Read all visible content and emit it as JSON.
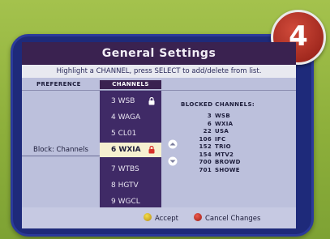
{
  "step_badge": "4",
  "title": "General Settings",
  "instruction": "Highlight a CHANNEL, press SELECT to add/delete from list.",
  "columns": {
    "preference": "PREFERENCE",
    "channels": "CHANNELS"
  },
  "preference_label": "Block: Channels",
  "channels": [
    {
      "label": "3 WSB",
      "locked": true,
      "selected": false
    },
    {
      "label": "4 WAGA",
      "locked": false,
      "selected": false
    },
    {
      "label": "5 CL01",
      "locked": false,
      "selected": false
    },
    {
      "label": "6 WXIA",
      "locked": true,
      "selected": true
    },
    {
      "label": "7 WTBS",
      "locked": false,
      "selected": false
    },
    {
      "label": "8 HGTV",
      "locked": false,
      "selected": false
    },
    {
      "label": "9 WGCL",
      "locked": false,
      "selected": false
    }
  ],
  "blocked": {
    "heading": "BLOCKED CHANNELS:",
    "items": [
      {
        "num": "3",
        "name": "WSB"
      },
      {
        "num": "6",
        "name": "WXIA"
      },
      {
        "num": "22",
        "name": "USA"
      },
      {
        "num": "106",
        "name": "IFC"
      },
      {
        "num": "152",
        "name": "TRIO"
      },
      {
        "num": "154",
        "name": "MTV2"
      },
      {
        "num": "700",
        "name": "BROWD"
      },
      {
        "num": "701",
        "name": "SHOWE"
      }
    ]
  },
  "footer": {
    "accept": "Accept",
    "cancel": "Cancel Changes"
  },
  "colors": {
    "accent": "#3a2250",
    "selected": "#f6f0d0",
    "lock": "#d7302a"
  }
}
